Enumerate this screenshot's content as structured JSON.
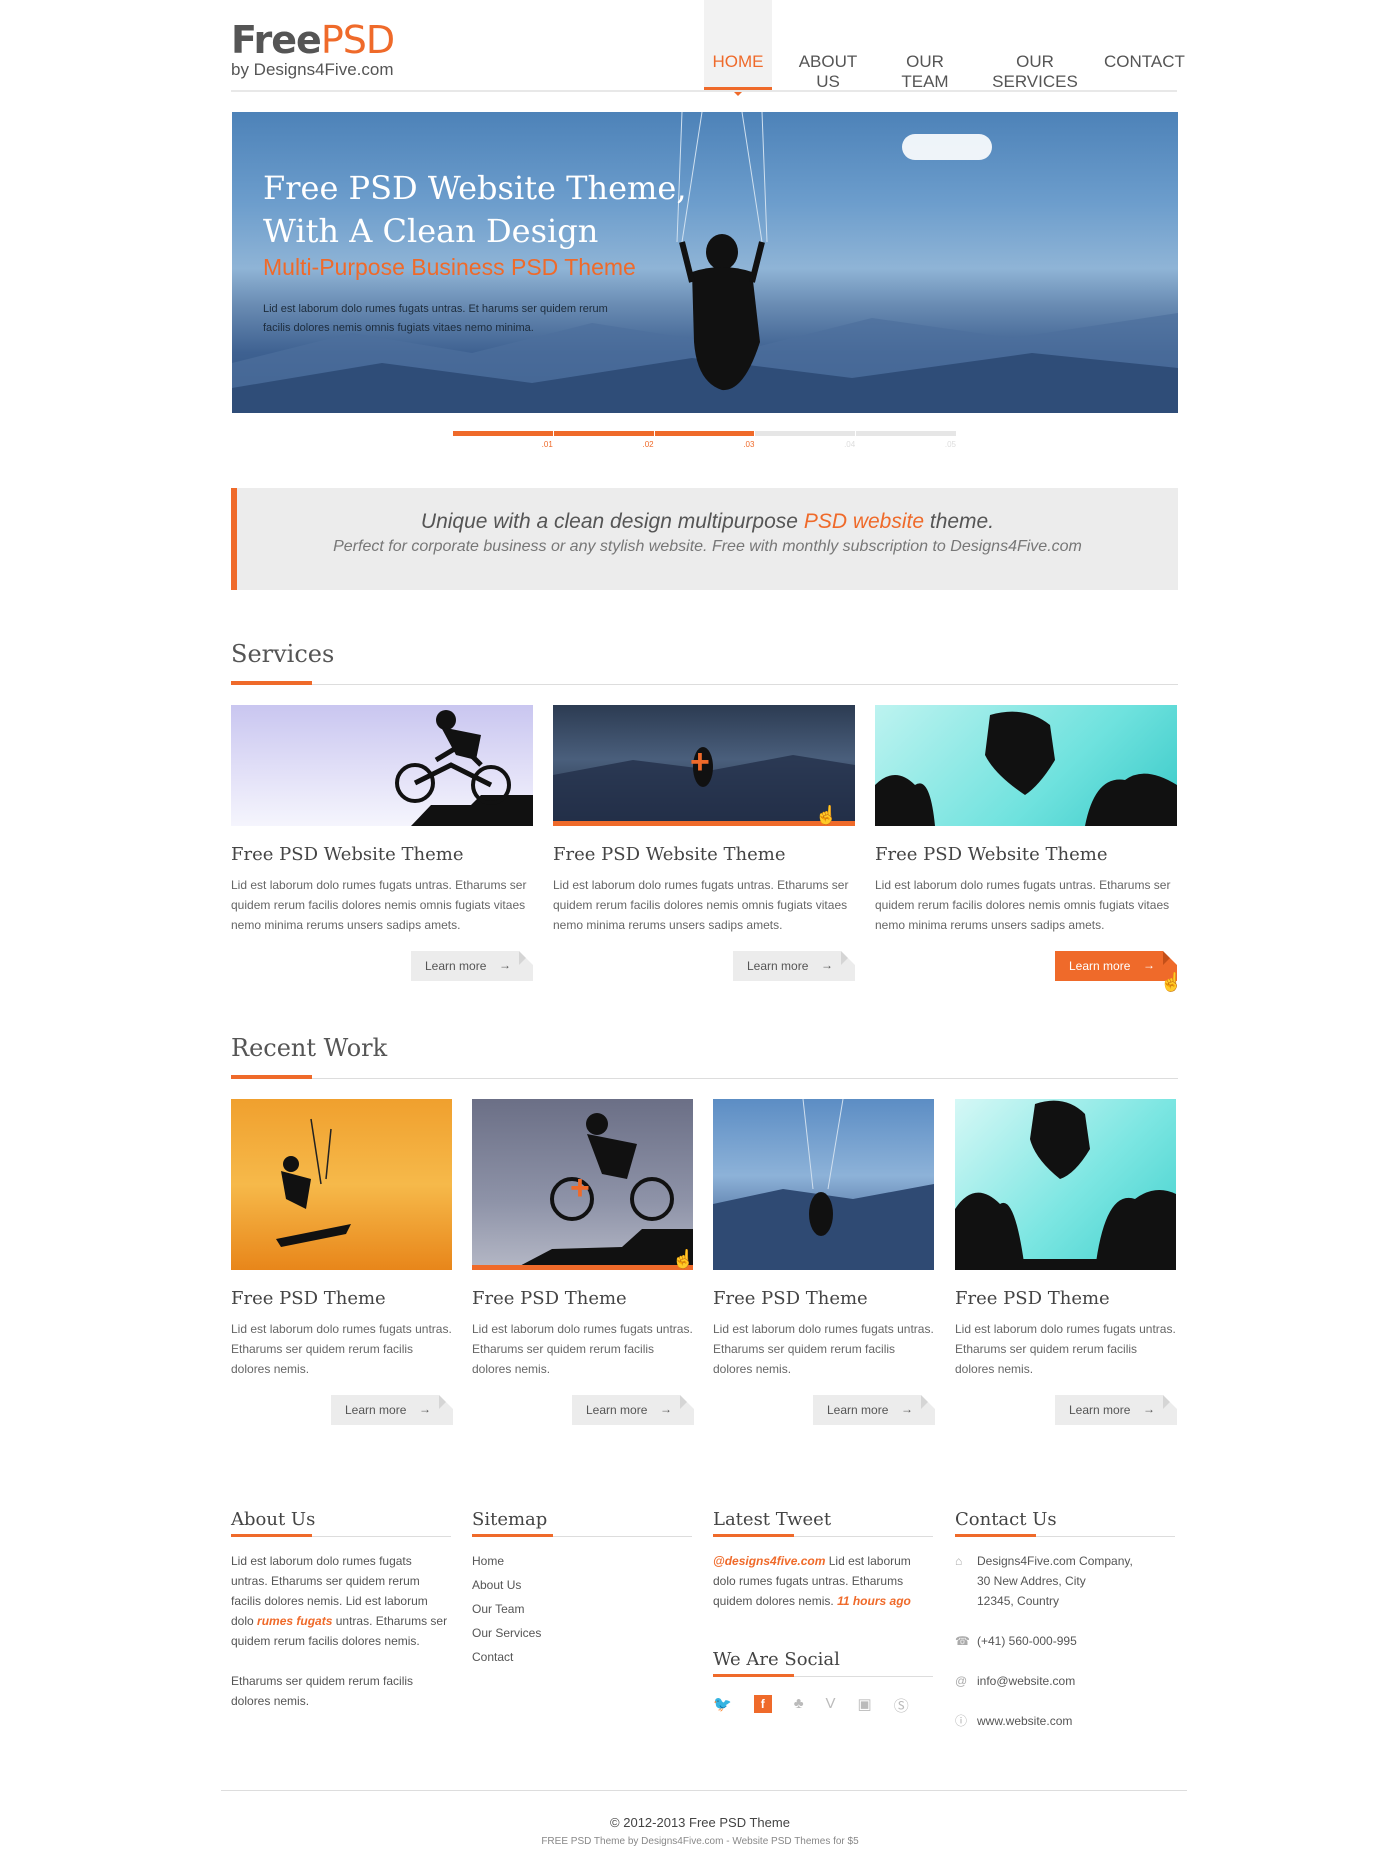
{
  "header": {
    "logo_free": "Free",
    "logo_psd": "PSD",
    "logo_sub": "by Designs4Five.com",
    "nav": [
      "HOME",
      "ABOUT US",
      "OUR TEAM",
      "OUR SERVICES",
      "CONTACT"
    ]
  },
  "hero": {
    "title_line1": "Free PSD Website Theme,",
    "title_line2": "With A Clean Design",
    "subtitle": "Multi-Purpose Business PSD Theme",
    "text": "Lid est laborum dolo rumes fugats untras. Et harums ser quidem rerum facilis dolores nemis omnis fugiats vitaes nemo minima.",
    "slides": [
      ".01",
      ".02",
      ".03",
      ".04",
      ".05"
    ],
    "active_slide_count": 3
  },
  "quote": {
    "main_before": "Unique with a clean design multipurpose ",
    "main_highlight": "PSD website",
    "main_after": " theme.",
    "sub": "Perfect for corporate business or any stylish website.  Free with monthly subscription to Designs4Five.com"
  },
  "services": {
    "title": "Services",
    "items": [
      {
        "title": "Free PSD Website Theme",
        "text": "Lid est laborum dolo rumes fugats untras. Etharums ser quidem rerum facilis dolores nemis omnis fugiats vitaes nemo minima rerums unsers sadips amets.",
        "button": "Learn more"
      },
      {
        "title": "Free PSD Website Theme",
        "text": "Lid est laborum dolo rumes fugats untras. Etharums ser quidem rerum facilis dolores nemis omnis fugiats vitaes nemo minima rerums unsers sadips amets.",
        "button": "Learn more"
      },
      {
        "title": "Free PSD Website Theme",
        "text": "Lid est laborum dolo rumes fugats untras. Etharums ser quidem rerum facilis dolores nemis omnis fugiats vitaes nemo minima rerums unsers sadips amets.",
        "button": "Learn more"
      }
    ]
  },
  "recent_work": {
    "title": "Recent Work",
    "items": [
      {
        "title": "Free PSD Theme",
        "text": "Lid est laborum dolo rumes fugats untras. Etharums ser quidem rerum facilis dolores nemis.",
        "button": "Learn more"
      },
      {
        "title": "Free PSD Theme",
        "text": "Lid est laborum dolo rumes fugats untras. Etharums ser quidem rerum facilis dolores nemis.",
        "button": "Learn more"
      },
      {
        "title": "Free PSD Theme",
        "text": "Lid est laborum dolo rumes fugats untras. Etharums ser quidem rerum facilis dolores nemis.",
        "button": "Learn more"
      },
      {
        "title": "Free PSD Theme",
        "text": "Lid est laborum dolo rumes fugats untras. Etharums ser quidem rerum facilis dolores nemis.",
        "button": "Learn more"
      }
    ]
  },
  "footer": {
    "about": {
      "title": "About Us",
      "p1_before": "Lid est laborum dolo rumes fugats untras. Etharums ser quidem rerum facilis dolores nemis. Lid est laborum dolo ",
      "p1_highlight": "rumes fugats",
      "p1_after": " untras. Etharums ser quidem rerum facilis dolores nemis.",
      "p2": "Etharums ser quidem rerum facilis dolores nemis."
    },
    "sitemap": {
      "title": "Sitemap",
      "links": [
        "Home",
        "About Us",
        "Our Team",
        "Our Services",
        "Contact"
      ]
    },
    "tweet": {
      "title": "Latest Tweet",
      "handle": "@designs4five.com",
      "text": " Lid est laborum dolo rumes fugats untras. Etharums quidem dolores nemis. ",
      "time": "11 hours ago"
    },
    "social": {
      "title": "We Are Social",
      "icons": [
        "twitter-icon",
        "facebook-icon",
        "myspace-icon",
        "vimeo-icon",
        "youtube-icon",
        "skype-icon"
      ]
    },
    "contact": {
      "title": "Contact Us",
      "address_line1": "Designs4Five.com Company,",
      "address_line2": "30 New Addres, City",
      "address_line3": "12345, Country",
      "phone": "(+41) 560-000-995",
      "email": "info@website.com",
      "web": "www.website.com"
    },
    "copyright": "© 2012-2013 Free PSD Theme",
    "credit": "FREE PSD Theme by Designs4Five.com - Website PSD Themes for $5"
  },
  "colors": {
    "accent": "#ef6a2a",
    "text": "#555555",
    "panel": "#ececec"
  }
}
